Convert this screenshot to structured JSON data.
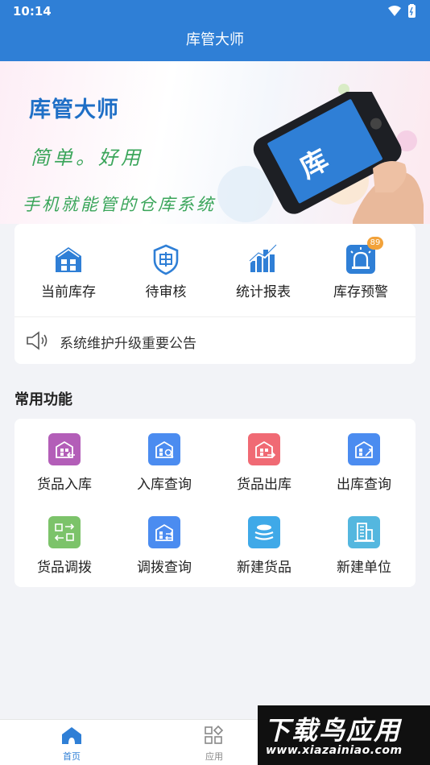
{
  "status": {
    "time": "10:14"
  },
  "app": {
    "title": "库管大师"
  },
  "banner": {
    "title": "库管大师",
    "slogan1": "简单。好用",
    "slogan2": "手机就能管的仓库系统",
    "phone_char": "库"
  },
  "quick_actions": [
    {
      "label": "当前库存",
      "icon": "warehouse-icon",
      "color": "#2f7fd6"
    },
    {
      "label": "待审核",
      "icon": "shield-audit-icon",
      "color": "#2f7fd6"
    },
    {
      "label": "统计报表",
      "icon": "bar-chart-icon",
      "color": "#2f7fd6"
    },
    {
      "label": "库存预警",
      "icon": "alarm-light-icon",
      "color": "#2f7fd6",
      "badge": "89"
    }
  ],
  "notice": {
    "text": "系统维护升级重要公告",
    "icon": "speaker-icon"
  },
  "common": {
    "title": "常用功能",
    "items": [
      {
        "label": "货品入库",
        "icon": "goods-in-icon",
        "color": "#b35eb8"
      },
      {
        "label": "入库查询",
        "icon": "in-query-icon",
        "color": "#4b8cf0"
      },
      {
        "label": "货品出库",
        "icon": "goods-out-icon",
        "color": "#f06a74"
      },
      {
        "label": "出库查询",
        "icon": "out-query-icon",
        "color": "#4b8cf0"
      },
      {
        "label": "货品调拨",
        "icon": "transfer-icon",
        "color": "#7cc36a"
      },
      {
        "label": "调拨查询",
        "icon": "transfer-query-icon",
        "color": "#4b8cf0"
      },
      {
        "label": "新建货品",
        "icon": "new-goods-icon",
        "color": "#3fa9e8"
      },
      {
        "label": "新建单位",
        "icon": "new-unit-icon",
        "color": "#54b7df"
      }
    ]
  },
  "nav": {
    "active_color": "#2f7fd6",
    "inactive_color": "#888888",
    "items": [
      {
        "label": "首页",
        "icon": "home-icon"
      },
      {
        "label": "应用",
        "icon": "apps-icon"
      }
    ]
  },
  "watermark": {
    "big": "下载鸟应用",
    "small": "www.xiazainiao.com"
  }
}
